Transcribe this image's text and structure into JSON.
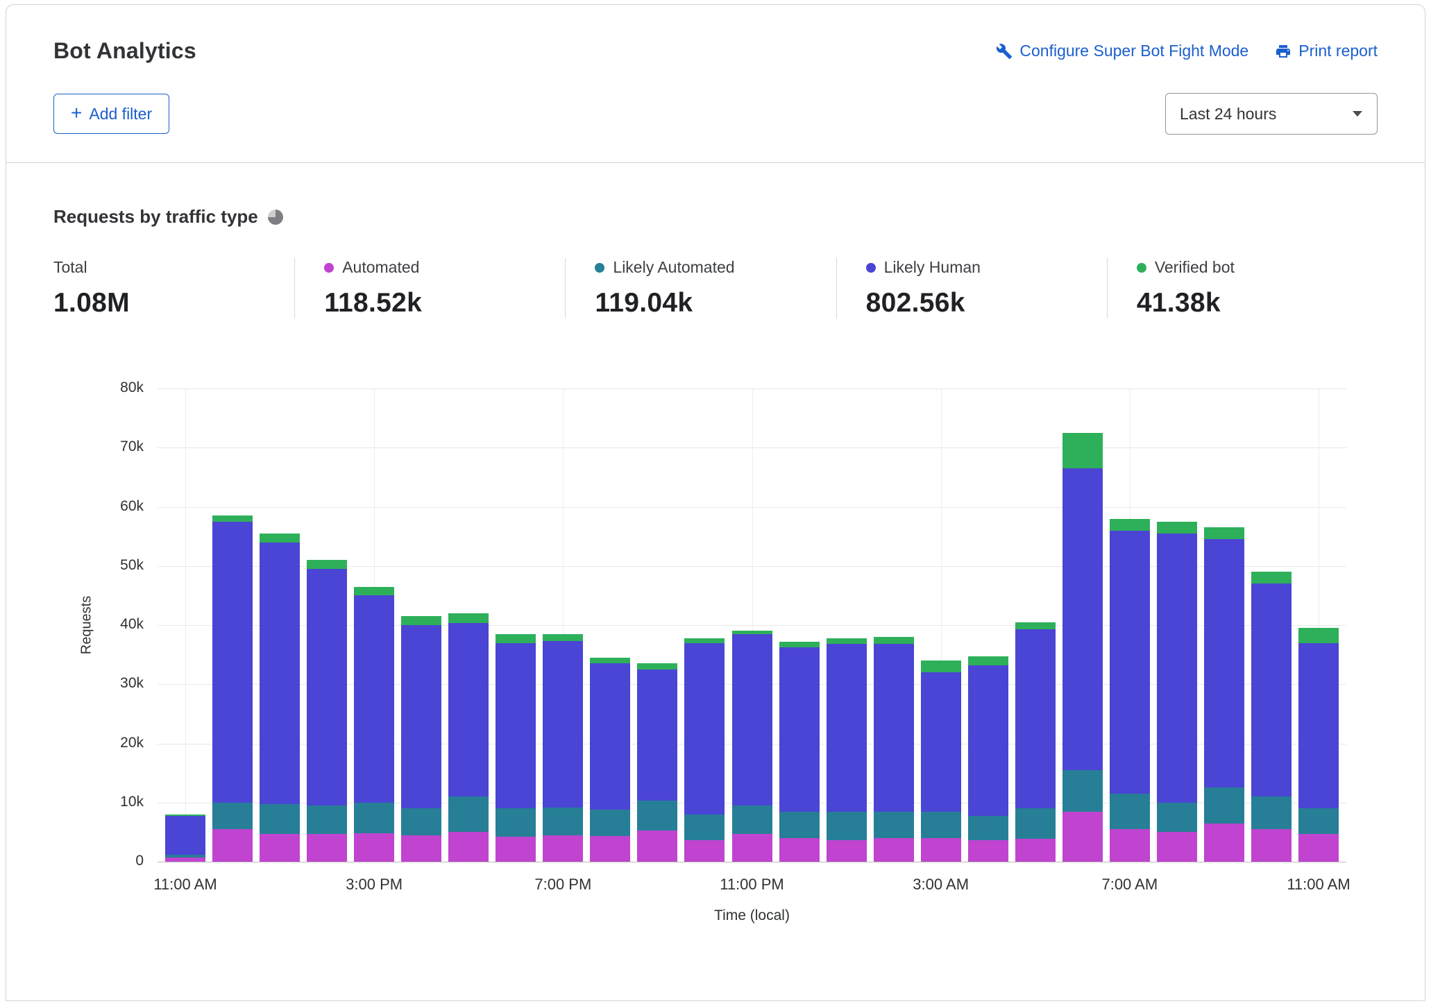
{
  "header": {
    "title": "Bot Analytics",
    "configure_link": "Configure Super Bot Fight Mode",
    "print_link": "Print report",
    "add_filter_label": "Add filter",
    "time_range": "Last 24 hours"
  },
  "section": {
    "title": "Requests by traffic type"
  },
  "colors": {
    "link_blue": "#1b5fce",
    "automated": "#c044d0",
    "likely_automated": "#267f96",
    "likely_human": "#4a45d4",
    "verified_bot": "#2eb05a"
  },
  "stats": [
    {
      "label": "Total",
      "value": "1.08M",
      "color": null
    },
    {
      "label": "Automated",
      "value": "118.52k",
      "color": "#c044d0"
    },
    {
      "label": "Likely Automated",
      "value": "119.04k",
      "color": "#267f96"
    },
    {
      "label": "Likely Human",
      "value": "802.56k",
      "color": "#4a45d4"
    },
    {
      "label": "Verified bot",
      "value": "41.38k",
      "color": "#2eb05a"
    }
  ],
  "chart_data": {
    "type": "bar",
    "stacked": true,
    "title": "Requests by traffic type",
    "xlabel": "Time (local)",
    "ylabel": "Requests",
    "ylim": [
      0,
      80000
    ],
    "ytick_step": 10000,
    "ytick_labels": [
      "0",
      "10k",
      "20k",
      "30k",
      "40k",
      "50k",
      "60k",
      "70k",
      "80k"
    ],
    "grid": true,
    "legend_position": "top-stats-row",
    "x": [
      "11:00 AM",
      "12:00 PM",
      "1:00 PM",
      "2:00 PM",
      "3:00 PM",
      "4:00 PM",
      "5:00 PM",
      "6:00 PM",
      "7:00 PM",
      "8:00 PM",
      "9:00 PM",
      "10:00 PM",
      "11:00 PM",
      "12:00 AM",
      "1:00 AM",
      "2:00 AM",
      "3:00 AM",
      "4:00 AM",
      "5:00 AM",
      "6:00 AM",
      "7:00 AM",
      "8:00 AM",
      "9:00 AM",
      "10:00 AM",
      "11:00 AM"
    ],
    "x_tick_indices": [
      0,
      4,
      8,
      12,
      16,
      20,
      24
    ],
    "x_tick_labels": [
      "11:00 AM",
      "3:00 PM",
      "7:00 PM",
      "11:00 PM",
      "3:00 AM",
      "7:00 AM",
      "11:00 AM"
    ],
    "series": [
      {
        "name": "Automated",
        "color": "#c044d0",
        "values": [
          700,
          5500,
          4700,
          4700,
          4800,
          4500,
          5000,
          4200,
          4500,
          4300,
          5300,
          3600,
          4700,
          4000,
          3600,
          4000,
          4000,
          3600,
          3900,
          8500,
          5500,
          5000,
          6500,
          5500,
          4700
        ]
      },
      {
        "name": "Likely Automated",
        "color": "#267f96",
        "values": [
          500,
          4500,
          5000,
          4800,
          5200,
          4500,
          6000,
          4800,
          4700,
          4500,
          5000,
          4400,
          4800,
          4500,
          4900,
          4500,
          4500,
          4200,
          5100,
          7000,
          6000,
          5000,
          6000,
          5500,
          4300
        ]
      },
      {
        "name": "Likely Human",
        "color": "#4a45d4",
        "values": [
          6600,
          47500,
          44300,
          40000,
          35000,
          31000,
          29300,
          28000,
          28100,
          24700,
          22200,
          29000,
          29000,
          27700,
          28300,
          28300,
          23500,
          25400,
          30300,
          51000,
          44500,
          45500,
          42000,
          36000,
          28000
        ]
      },
      {
        "name": "Verified bot",
        "color": "#2eb05a",
        "values": [
          200,
          1000,
          1500,
          1500,
          1500,
          1500,
          1700,
          1500,
          1200,
          1000,
          1000,
          800,
          600,
          1000,
          1000,
          1200,
          2000,
          1500,
          1200,
          6000,
          2000,
          2000,
          2000,
          2000,
          2500
        ]
      }
    ]
  }
}
